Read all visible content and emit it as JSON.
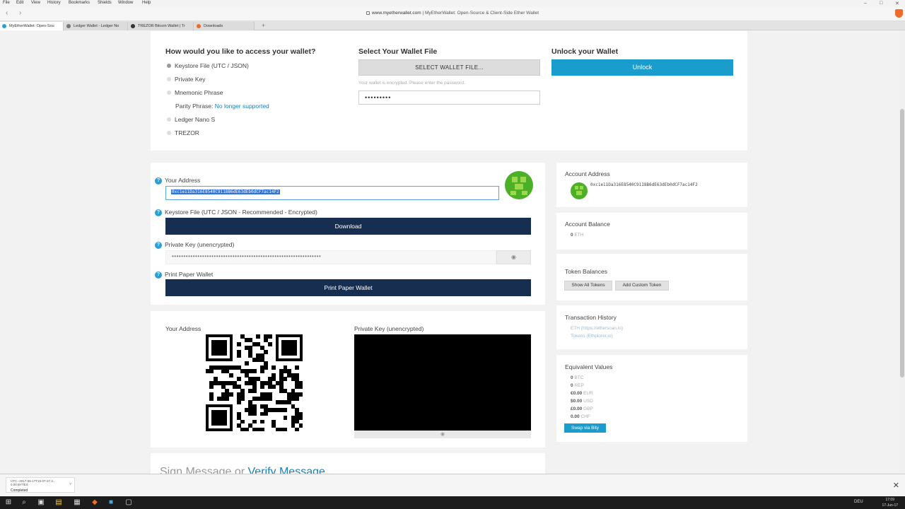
{
  "menu": [
    "File",
    "Edit",
    "View",
    "History",
    "Bookmarks",
    "Shields",
    "Window",
    "Help"
  ],
  "window_controls": [
    "–",
    "□",
    "✕"
  ],
  "nav": {
    "back": "‹",
    "forward": "›"
  },
  "address_bar": {
    "domain": "www.myetherwallet.com",
    "title": " | MyEtherWallet: Open-Source & Client-Side Ether Wallet"
  },
  "tabs": [
    {
      "label": "MyEtherWallet: Open-Sou",
      "icon_color": "#2b9fd5"
    },
    {
      "label": "Ledger Wallet - Ledger No",
      "icon_color": "#777777"
    },
    {
      "label": "TREZOR Bitcoin Wallet | Tr",
      "icon_color": "#333333"
    },
    {
      "label": "Downloads",
      "icon_color": "#f06a2a"
    }
  ],
  "new_tab": "+",
  "access": {
    "heading": "How would you like to access your wallet?",
    "options": [
      {
        "label": "Keystore File (UTC / JSON)",
        "selected": true
      },
      {
        "label": "Private Key",
        "selected": false
      },
      {
        "label": "Mnemonic Phrase",
        "selected": false
      },
      {
        "label": "Ledger Nano S",
        "selected": false
      },
      {
        "label": "TREZOR",
        "selected": false
      }
    ],
    "parity_label": "Parity Phrase:",
    "parity_link": "No longer supported"
  },
  "select_file": {
    "heading": "Select Your Wallet File",
    "button": "SELECT WALLET FILE...",
    "hint": "Your wallet is encrypted. Please enter the password.",
    "password": "•••••••••"
  },
  "unlock": {
    "heading": "Unlock your Wallet",
    "button": "Unlock"
  },
  "wallet": {
    "help": "?",
    "address_label": "Your Address",
    "address_value": "0xc1e11Da316E8540C9118B6dE63dEb0dCF7ac14F2",
    "keystore_label": "Keystore File (UTC / JSON - Recommended - Encrypted)",
    "download_button": "Download",
    "private_key_label": "Private Key (unencrypted)",
    "private_key_masked": "••••••••••••••••••••••••••••••••••••••••••••••••••••••••••••••••",
    "eye_icon": "◉",
    "paper_label": "Print Paper Wallet",
    "paper_button": "Print Paper Wallet"
  },
  "paper": {
    "address_label": "Your Address",
    "private_key_label": "Private Key (unencrypted)",
    "eye_icon": "◉"
  },
  "sidebar": {
    "account_address_label": "Account Address",
    "account_address": "0xc1e11Da316E8540C9118B6dE63dEb0dCF7ac14F2",
    "balance_label": "Account Balance",
    "balance_value": "0",
    "balance_unit": "ETH",
    "token_label": "Token Balances",
    "show_tokens": "Show All Tokens",
    "add_token": "Add Custom Token",
    "history_label": "Transaction History",
    "history_eth": "ETH (https://etherscan.io)",
    "history_tokens": "Tokens (Ethplorer.io)",
    "equiv_label": "Equivalent Values",
    "equiv": [
      {
        "value": "0",
        "unit": "BTC"
      },
      {
        "value": "0",
        "unit": "REP"
      },
      {
        "value": "€0.00",
        "unit": "EUR"
      },
      {
        "value": "$0.00",
        "unit": "USD"
      },
      {
        "value": "£0.00",
        "unit": "GBP"
      },
      {
        "value": "0.00",
        "unit": "CHF"
      }
    ],
    "swap_button": "Swap via Bity"
  },
  "sign": {
    "text": "Sign Message",
    "or": " or ",
    "link": "Verify Message"
  },
  "download": {
    "filename": "UTC--2017-06-17T15-07-27.3...",
    "size": "0.00 BYTES",
    "status": "Completed",
    "chevron": "˅",
    "close": "✕"
  },
  "taskbar": {
    "icons": [
      "⊞",
      "⌕",
      "▣",
      "▤",
      "▦",
      "◆",
      "■",
      "▢",
      "◎"
    ],
    "time": "17:09",
    "date": "17-Jun-17",
    "lang": "DEU"
  }
}
